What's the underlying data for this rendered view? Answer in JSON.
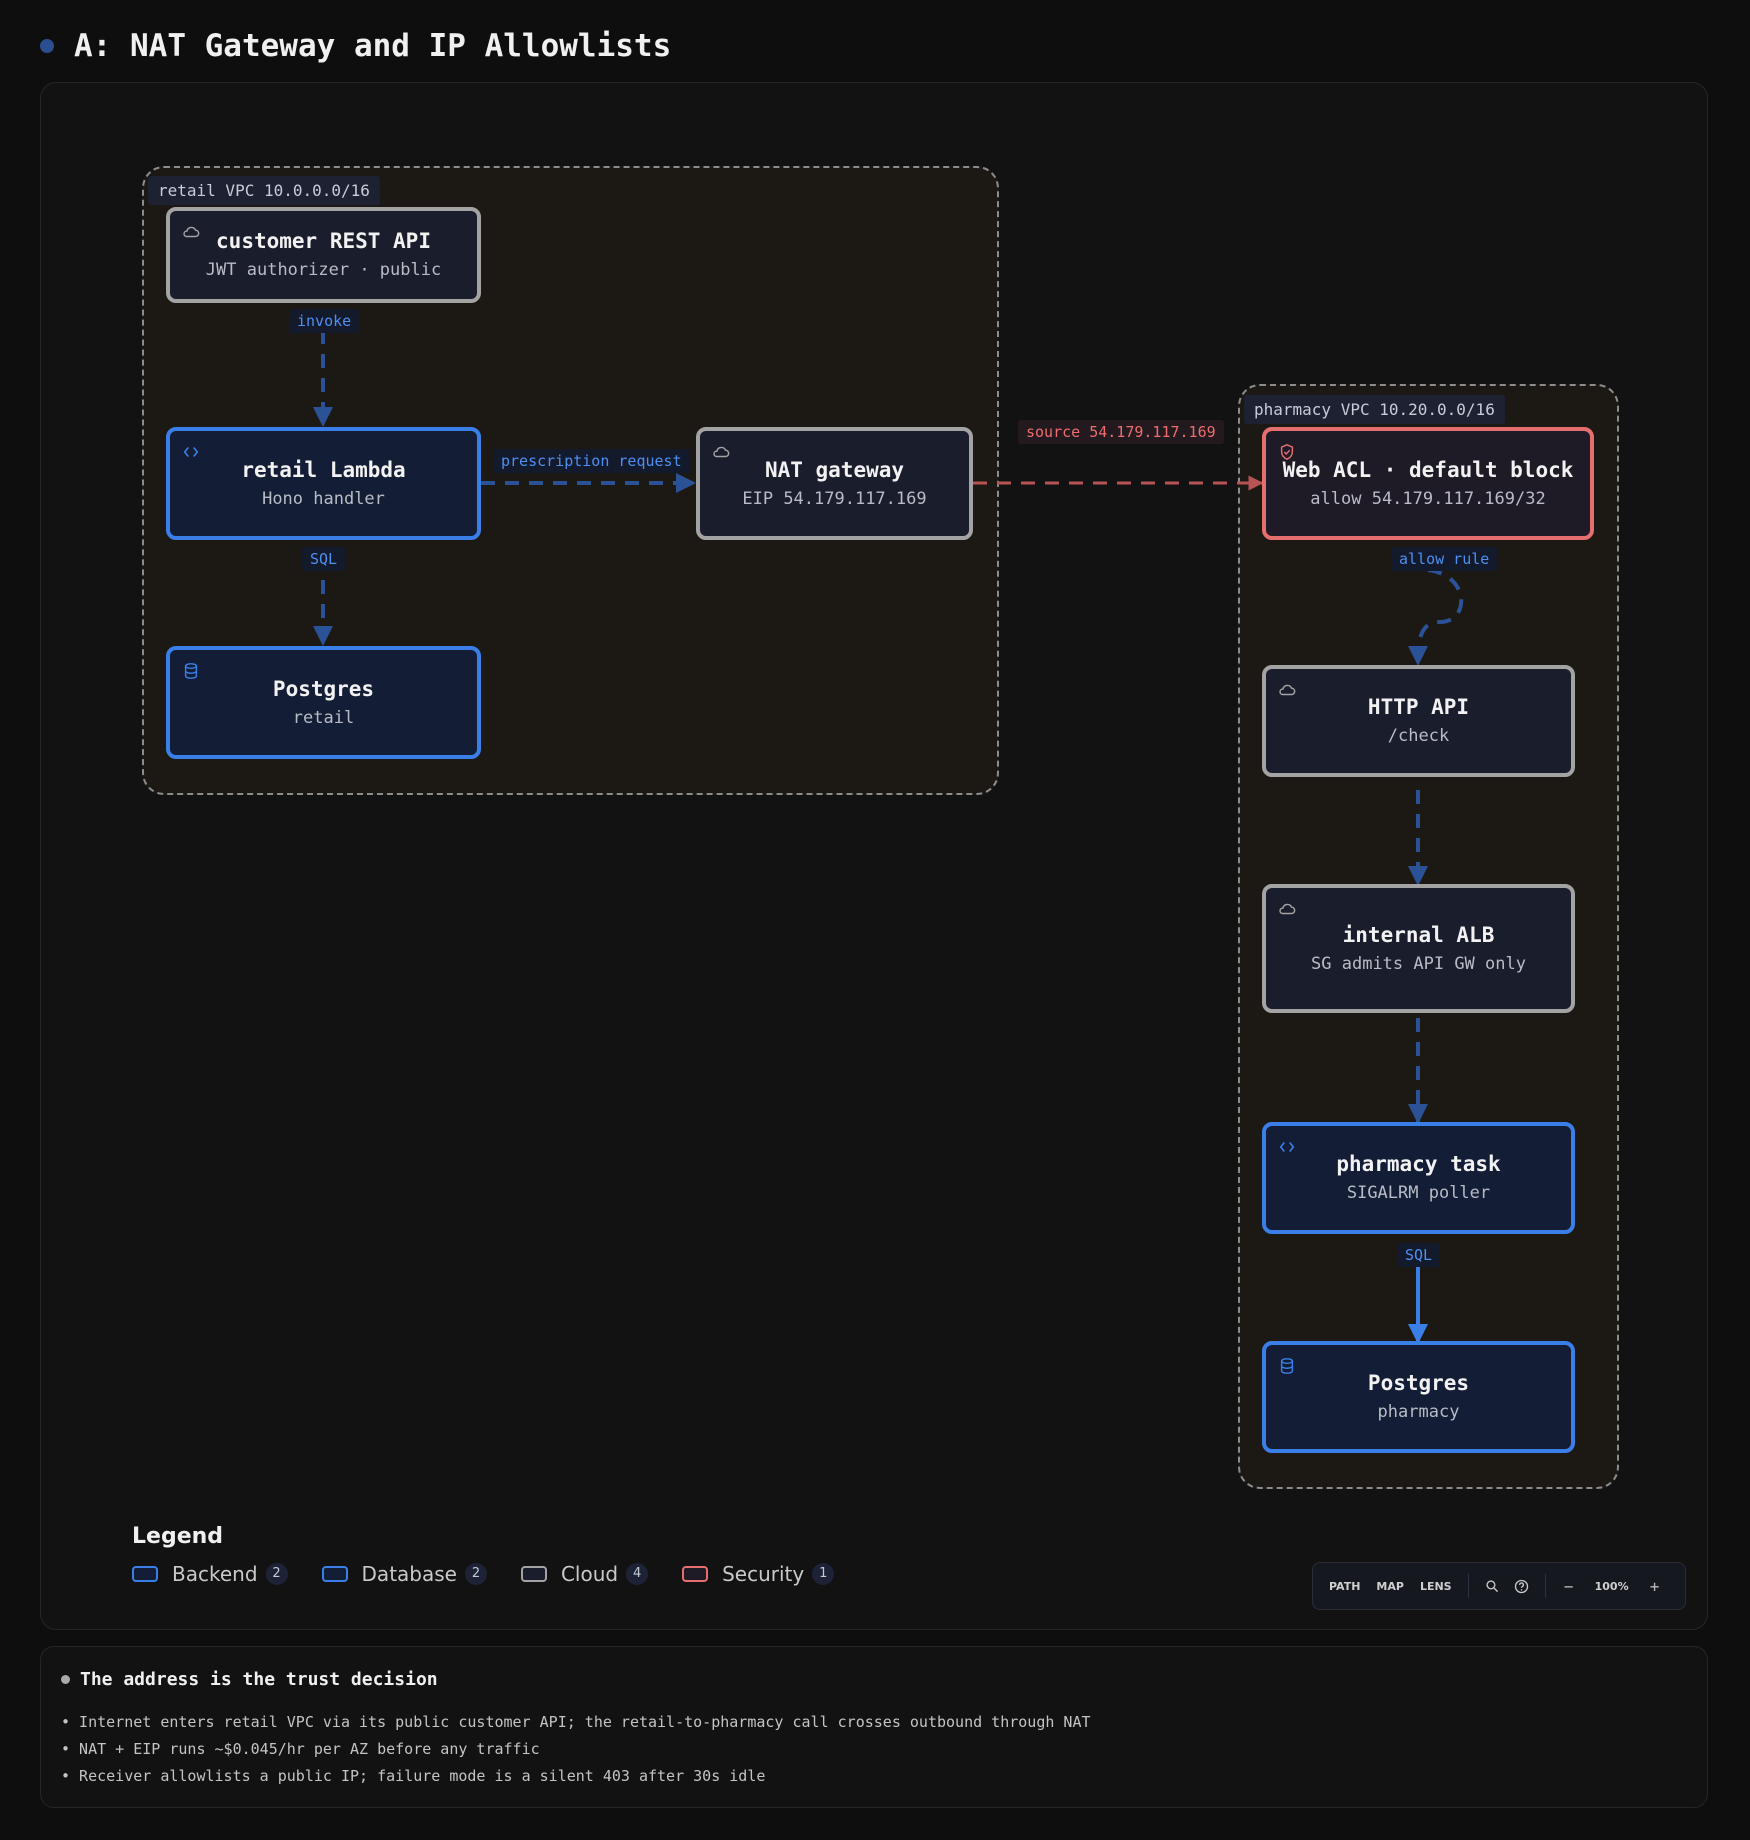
{
  "page": {
    "title": "A: NAT Gateway and IP Allowlists"
  },
  "groups": {
    "retail": {
      "label": "retail VPC 10.0.0.0/16"
    },
    "pharmacy": {
      "label": "pharmacy VPC 10.20.0.0/16"
    }
  },
  "nodes": {
    "customer_api": {
      "title": "customer REST API",
      "subtitle": "JWT authorizer · public",
      "kind": "cloud",
      "icon": "cloud-icon"
    },
    "retail_lambda": {
      "title": "retail Lambda",
      "subtitle": "Hono handler",
      "kind": "backend",
      "icon": "code-icon"
    },
    "retail_postgres": {
      "title": "Postgres",
      "subtitle": "retail",
      "kind": "database",
      "icon": "database-icon"
    },
    "nat_gateway": {
      "title": "NAT gateway",
      "subtitle": "EIP 54.179.117.169",
      "kind": "cloud",
      "icon": "cloud-icon"
    },
    "web_acl": {
      "title": "Web ACL · default block",
      "subtitle": "allow 54.179.117.169/32",
      "kind": "security",
      "icon": "shield-icon"
    },
    "http_api": {
      "title": "HTTP API",
      "subtitle": "/check",
      "kind": "cloud",
      "icon": "cloud-icon"
    },
    "internal_alb": {
      "title": "internal ALB",
      "subtitle": "SG admits API GW only",
      "kind": "cloud",
      "icon": "cloud-icon"
    },
    "pharmacy_task": {
      "title": "pharmacy task",
      "subtitle": "SIGALRM poller",
      "kind": "backend",
      "icon": "code-icon"
    },
    "pharmacy_postgres": {
      "title": "Postgres",
      "subtitle": "pharmacy",
      "kind": "database",
      "icon": "database-icon"
    }
  },
  "edges": {
    "invoke": "invoke",
    "sql_retail": "SQL",
    "prescription": "prescription request",
    "source": "source 54.179.117.169",
    "allow_rule": "allow rule",
    "sql_pharmacy": "SQL"
  },
  "legend": {
    "title": "Legend",
    "items": [
      {
        "label": "Backend",
        "count": "2",
        "color": "#3a7fe8"
      },
      {
        "label": "Database",
        "count": "2",
        "color": "#3a7fe8"
      },
      {
        "label": "Cloud",
        "count": "4",
        "color": "#a3a3a3"
      },
      {
        "label": "Security",
        "count": "1",
        "color": "#e56f6f"
      }
    ]
  },
  "toolbar": {
    "path": "PATH",
    "map": "MAP",
    "lens": "LENS",
    "zoom": "100%",
    "minus": "−",
    "plus": "+"
  },
  "notes": {
    "title": "The address is the trust decision",
    "items": [
      "• Internet enters retail VPC via its public customer API; the retail-to-pharmacy call crosses outbound through NAT",
      "• NAT + EIP runs ~$0.045/hr per AZ before any traffic",
      "• Receiver allowlists a public IP; failure mode is a silent 403 after 30s idle"
    ]
  },
  "colors": {
    "accent_blue": "#3a7fe8",
    "edge_blue": "#2b5296",
    "edge_red": "#b85454",
    "security_red": "#e56f6f",
    "cloud_gray": "#a3a3a3"
  }
}
